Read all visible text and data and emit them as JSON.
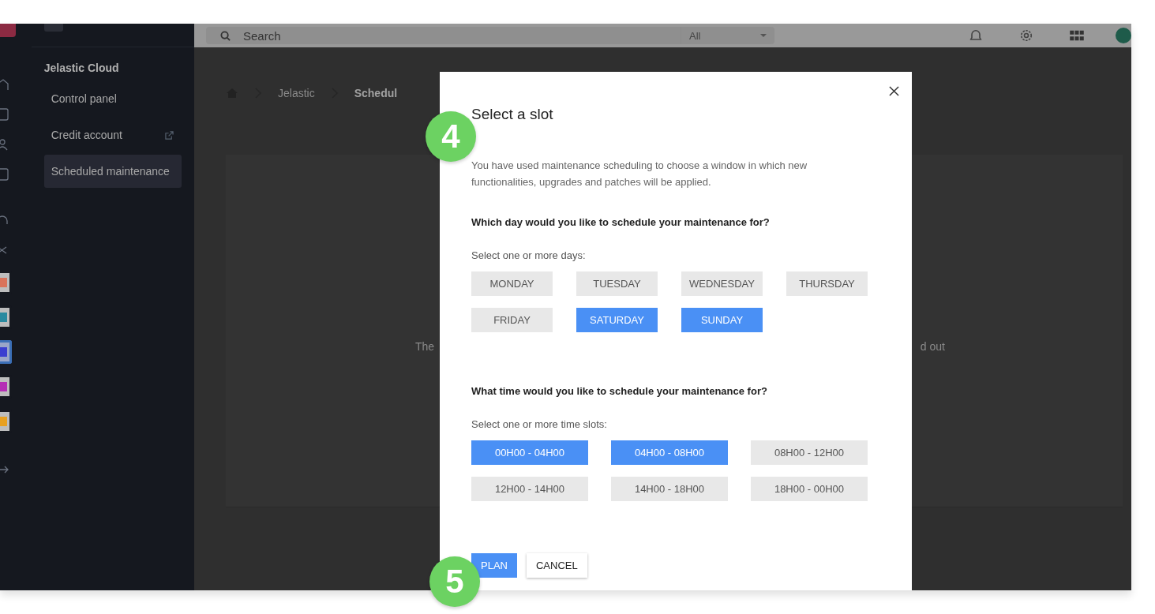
{
  "topbar": {
    "search": {
      "placeholder": "Search"
    },
    "scope": "All"
  },
  "rail_apps": [
    {
      "selected": false
    },
    {
      "selected": false
    },
    {
      "selected": true
    },
    {
      "selected": false
    },
    {
      "selected": false
    }
  ],
  "sidebar": {
    "title": "Jelastic Cloud",
    "items": [
      {
        "label": "Control panel",
        "selected": false,
        "external": false
      },
      {
        "label": "Credit account",
        "selected": false,
        "external": true
      },
      {
        "label": "Scheduled maintenance",
        "selected": true,
        "external": false
      }
    ]
  },
  "breadcrumb": [
    "Jelastic",
    "Schedul"
  ],
  "background_text": [
    "The",
    "d out"
  ],
  "dialog": {
    "title": "Select a slot",
    "description": "You have used maintenance scheduling to choose a window in which new functionalities, upgrades and patches will be applied.",
    "day_question": "Which day would you like to schedule your maintenance for?",
    "day_hint": "Select one or more days:",
    "days": [
      {
        "label": "MONDAY",
        "selected": false
      },
      {
        "label": "TUESDAY",
        "selected": false
      },
      {
        "label": "WEDNESDAY",
        "selected": false
      },
      {
        "label": "THURSDAY",
        "selected": false
      },
      {
        "label": "FRIDAY",
        "selected": false
      },
      {
        "label": "SATURDAY",
        "selected": true
      },
      {
        "label": "SUNDAY",
        "selected": true
      }
    ],
    "time_question": "What time would you like to schedule your maintenance for?",
    "time_hint": "Select one or more time slots:",
    "times": [
      {
        "label": "00H00 - 04H00",
        "selected": true
      },
      {
        "label": "04H00 - 08H00",
        "selected": true
      },
      {
        "label": "08H00 - 12H00",
        "selected": false
      },
      {
        "label": "12H00 - 14H00",
        "selected": false
      },
      {
        "label": "14H00 - 18H00",
        "selected": false
      },
      {
        "label": "18H00 - 00H00",
        "selected": false
      }
    ],
    "buttons": [
      {
        "label": "PLAN",
        "kind": "primary"
      },
      {
        "label": "CANCEL",
        "kind": "secondary"
      }
    ]
  },
  "step_badges": [
    "4",
    "5"
  ]
}
